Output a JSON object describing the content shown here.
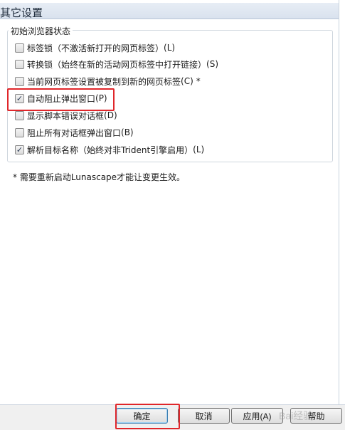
{
  "header": {
    "title": "其它设置"
  },
  "group": {
    "title": "初始浏览器状态",
    "options": [
      {
        "label": "标签锁（不激活新打开的网页标签）",
        "key": "(L)",
        "checked": false
      },
      {
        "label": "转换锁（始终在新的活动网页标签中打开链接）",
        "key": "(S)",
        "checked": false
      },
      {
        "label": "当前网页标签设置被复制到新的网页标签",
        "key": "(C)",
        "suffix": "*",
        "checked": false
      },
      {
        "label": "自动阻止弹出窗口",
        "key": "(P)",
        "checked": true
      },
      {
        "label": "显示脚本错误对话框",
        "key": "(D)",
        "checked": false
      },
      {
        "label": "阻止所有对话框弹出窗口",
        "key": "(B)",
        "checked": false
      },
      {
        "label": "解析目标名称（始终对非Trident引擎启用）",
        "key": "(L)",
        "checked": true
      }
    ]
  },
  "note": "* 需要重新启动Lunascape才能让变更生效。",
  "buttons": {
    "ok": "确定",
    "cancel": "取消",
    "apply": "应用(A)",
    "help": "帮助"
  },
  "watermark": "Bai经验",
  "colors": {
    "highlight": "#e0262a",
    "header_bg": "#dfe7f1"
  }
}
